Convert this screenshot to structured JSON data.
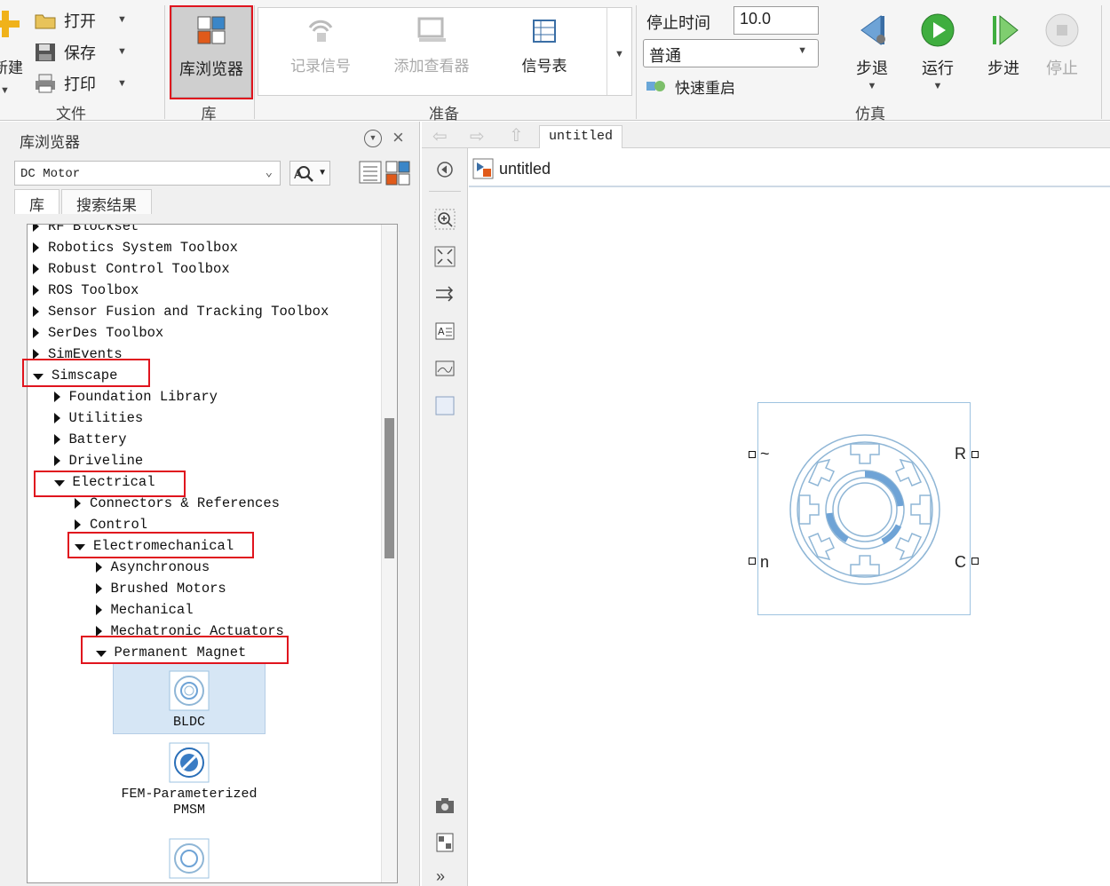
{
  "ribbon": {
    "file": {
      "new_label": "新建",
      "open_label": "打开",
      "save_label": "保存",
      "print_label": "打印",
      "group_title": "文件"
    },
    "library": {
      "browser_label": "库浏览器",
      "group_title": "库"
    },
    "prepare": {
      "log_signals_label": "记录信号",
      "add_viewer_label": "添加查看器",
      "signal_table_label": "信号表",
      "group_title": "准备"
    },
    "simulate": {
      "stop_time_label": "停止时间",
      "stop_time_value": "10.0",
      "mode_value": "普通",
      "fast_restart_label": "快速重启",
      "step_back_label": "步退",
      "run_label": "运行",
      "step_forward_label": "步进",
      "stop_label": "停止",
      "group_title": "仿真"
    }
  },
  "library_browser": {
    "title": "库浏览器",
    "search_value": "DC Motor",
    "tabs": [
      "库",
      "搜索结果"
    ],
    "tree": [
      {
        "label": "RF Blockset",
        "level": 0,
        "expanded": false
      },
      {
        "label": "Robotics System Toolbox",
        "level": 0,
        "expanded": false
      },
      {
        "label": "Robust Control Toolbox",
        "level": 0,
        "expanded": false
      },
      {
        "label": "ROS Toolbox",
        "level": 0,
        "expanded": false
      },
      {
        "label": "Sensor Fusion and Tracking Toolbox",
        "level": 0,
        "expanded": false
      },
      {
        "label": "SerDes Toolbox",
        "level": 0,
        "expanded": false
      },
      {
        "label": "SimEvents",
        "level": 0,
        "expanded": false
      },
      {
        "label": "Simscape",
        "level": 0,
        "expanded": true
      },
      {
        "label": "Foundation Library",
        "level": 1,
        "expanded": false
      },
      {
        "label": "Utilities",
        "level": 1,
        "expanded": false
      },
      {
        "label": "Battery",
        "level": 1,
        "expanded": false
      },
      {
        "label": "Driveline",
        "level": 1,
        "expanded": false
      },
      {
        "label": "Electrical",
        "level": 1,
        "expanded": true
      },
      {
        "label": "Connectors & References",
        "level": 2,
        "expanded": false
      },
      {
        "label": "Control",
        "level": 2,
        "expanded": false
      },
      {
        "label": "Electromechanical",
        "level": 2,
        "expanded": true
      },
      {
        "label": "Asynchronous",
        "level": 3,
        "expanded": false
      },
      {
        "label": "Brushed Motors",
        "level": 3,
        "expanded": false
      },
      {
        "label": "Mechanical",
        "level": 3,
        "expanded": false
      },
      {
        "label": "Mechatronic Actuators",
        "level": 3,
        "expanded": false
      },
      {
        "label": "Permanent Magnet",
        "level": 3,
        "expanded": true
      }
    ],
    "blocks": [
      {
        "label": "BLDC",
        "selected": true
      },
      {
        "label": "FEM-Parameterized\nPMSM",
        "selected": false
      }
    ]
  },
  "editor": {
    "tab_label": "untitled",
    "model_title": "untitled",
    "block_ports": {
      "left_top": "~",
      "left_bottom": "n",
      "right_top": "R",
      "right_bottom": "C"
    }
  },
  "colors": {
    "highlight": "#e0141e",
    "block_stroke": "#8fb6d6",
    "selection": "#d6e6f5"
  }
}
